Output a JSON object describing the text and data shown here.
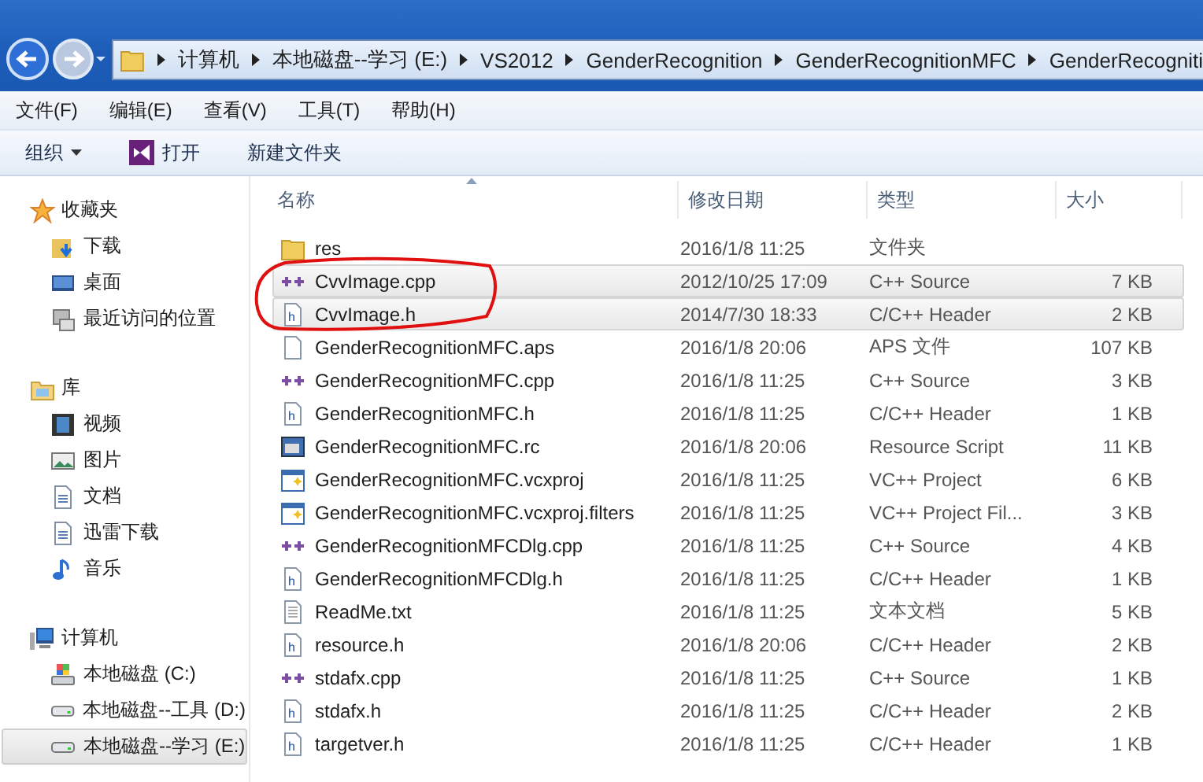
{
  "address_bar": {
    "segments": [
      "计算机",
      "本地磁盘--学习 (E:)",
      "VS2012",
      "GenderRecognition",
      "GenderRecognitionMFC",
      "GenderRecogniti"
    ]
  },
  "menu_bar": [
    "文件(F)",
    "编辑(E)",
    "查看(V)",
    "工具(T)",
    "帮助(H)"
  ],
  "toolbar": {
    "organize": "组织",
    "open": "打开",
    "new_folder": "新建文件夹"
  },
  "sidebar": {
    "groups": [
      {
        "label": "收藏夹",
        "kind": "star",
        "children": [
          {
            "label": "下载",
            "kind": "download",
            "selected": false
          },
          {
            "label": "桌面",
            "kind": "desktop",
            "selected": false
          },
          {
            "label": "最近访问的位置",
            "kind": "recent",
            "selected": false
          }
        ]
      },
      {
        "label": "库",
        "kind": "library",
        "children": [
          {
            "label": "视频",
            "kind": "video",
            "selected": false
          },
          {
            "label": "图片",
            "kind": "picture",
            "selected": false
          },
          {
            "label": "文档",
            "kind": "doc",
            "selected": false
          },
          {
            "label": "迅雷下载",
            "kind": "doc",
            "selected": false
          },
          {
            "label": "音乐",
            "kind": "music",
            "selected": false
          }
        ]
      },
      {
        "label": "计算机",
        "kind": "computer",
        "children": [
          {
            "label": "本地磁盘 (C:)",
            "kind": "sysdrive",
            "selected": false
          },
          {
            "label": "本地磁盘--工具 (D:)",
            "kind": "drive",
            "selected": false
          },
          {
            "label": "本地磁盘--学习 (E:)",
            "kind": "drive",
            "selected": true
          }
        ]
      }
    ]
  },
  "file_list": {
    "columns": [
      "名称",
      "修改日期",
      "类型",
      "大小"
    ],
    "rows": [
      {
        "name": "res",
        "date": "2016/1/8 11:25",
        "type": "文件夹",
        "size": "",
        "kind": "folder",
        "selected": false
      },
      {
        "name": "CvvImage.cpp",
        "date": "2012/10/25 17:09",
        "type": "C++ Source",
        "size": "7 KB",
        "kind": "cpp",
        "selected": true
      },
      {
        "name": "CvvImage.h",
        "date": "2014/7/30 18:33",
        "type": "C/C++ Header",
        "size": "2 KB",
        "kind": "h",
        "selected": true
      },
      {
        "name": "GenderRecognitionMFC.aps",
        "date": "2016/1/8 20:06",
        "type": "APS 文件",
        "size": "107 KB",
        "kind": "blank",
        "selected": false
      },
      {
        "name": "GenderRecognitionMFC.cpp",
        "date": "2016/1/8 11:25",
        "type": "C++ Source",
        "size": "3 KB",
        "kind": "cpp",
        "selected": false
      },
      {
        "name": "GenderRecognitionMFC.h",
        "date": "2016/1/8 11:25",
        "type": "C/C++ Header",
        "size": "1 KB",
        "kind": "h",
        "selected": false
      },
      {
        "name": "GenderRecognitionMFC.rc",
        "date": "2016/1/8 20:06",
        "type": "Resource Script",
        "size": "11 KB",
        "kind": "rc",
        "selected": false
      },
      {
        "name": "GenderRecognitionMFC.vcxproj",
        "date": "2016/1/8 11:25",
        "type": "VC++ Project",
        "size": "6 KB",
        "kind": "proj",
        "selected": false
      },
      {
        "name": "GenderRecognitionMFC.vcxproj.filters",
        "date": "2016/1/8 11:25",
        "type": "VC++ Project Fil...",
        "size": "3 KB",
        "kind": "proj",
        "selected": false
      },
      {
        "name": "GenderRecognitionMFCDlg.cpp",
        "date": "2016/1/8 11:25",
        "type": "C++ Source",
        "size": "4 KB",
        "kind": "cpp",
        "selected": false
      },
      {
        "name": "GenderRecognitionMFCDlg.h",
        "date": "2016/1/8 11:25",
        "type": "C/C++ Header",
        "size": "1 KB",
        "kind": "h",
        "selected": false
      },
      {
        "name": "ReadMe.txt",
        "date": "2016/1/8 11:25",
        "type": "文本文档",
        "size": "5 KB",
        "kind": "txt",
        "selected": false
      },
      {
        "name": "resource.h",
        "date": "2016/1/8 20:06",
        "type": "C/C++ Header",
        "size": "2 KB",
        "kind": "h",
        "selected": false
      },
      {
        "name": "stdafx.cpp",
        "date": "2016/1/8 11:25",
        "type": "C++ Source",
        "size": "1 KB",
        "kind": "cpp",
        "selected": false
      },
      {
        "name": "stdafx.h",
        "date": "2016/1/8 11:25",
        "type": "C/C++ Header",
        "size": "2 KB",
        "kind": "h",
        "selected": false
      },
      {
        "name": "targetver.h",
        "date": "2016/1/8 11:25",
        "type": "C/C++ Header",
        "size": "1 KB",
        "kind": "h",
        "selected": false
      }
    ]
  }
}
